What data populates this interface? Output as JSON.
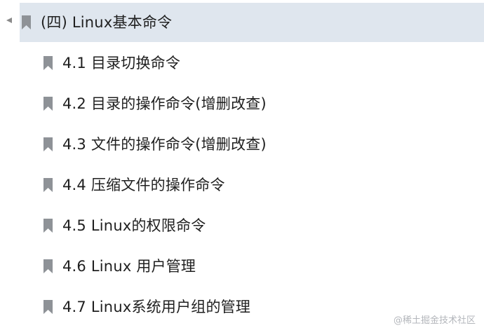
{
  "outline": {
    "parent": {
      "label": "(四) Linux基本命令",
      "expanded": true
    },
    "children": [
      {
        "label": "4.1 目录切换命令"
      },
      {
        "label": "4.2 目录的操作命令(增删改查)"
      },
      {
        "label": "4.3 文件的操作命令(增删改查)"
      },
      {
        "label": "4.4 压缩文件的操作命令"
      },
      {
        "label": "4.5 Linux的权限命令"
      },
      {
        "label": "4.6 Linux 用户管理"
      },
      {
        "label": "4.7 Linux系统用户组的管理"
      }
    ]
  },
  "watermark": {
    "text": "@稀土掘金技术社区"
  },
  "colors": {
    "selected_row_bg": "#dfe6ee",
    "bookmark_icon": "#8e9297",
    "text": "#1f1f1f"
  },
  "icons": {
    "expand": "triangle-left-icon",
    "bookmark": "bookmark-icon"
  }
}
